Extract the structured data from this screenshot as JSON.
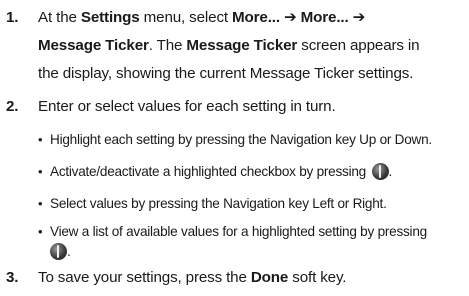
{
  "steps": [
    {
      "number": "1.",
      "lines": [
        [
          {
            "text": "At the ",
            "bold": false
          },
          {
            "text": "Settings",
            "bold": true
          },
          {
            "text": " menu, select ",
            "bold": false
          },
          {
            "text": "More... ➔ More... ➔",
            "bold": true
          }
        ],
        [
          {
            "text": "Message Ticker",
            "bold": true
          },
          {
            "text": ". The ",
            "bold": false
          },
          {
            "text": "Message Ticker",
            "bold": true
          },
          {
            "text": " screen appears in",
            "bold": false
          }
        ],
        [
          {
            "text": "the display, showing the current Message Ticker settings.",
            "bold": false
          }
        ]
      ]
    },
    {
      "number": "2.",
      "lines": [
        [
          {
            "text": "Enter or select values for each setting in turn.",
            "bold": false
          }
        ]
      ],
      "bullets": [
        "Highlight each setting by pressing the Navigation key Up or Down.",
        "Activate/deactivate a highlighted checkbox by pressing",
        "Select values by pressing the Navigation key Left or Right.",
        "View a list of available values for a highlighted setting by pressing"
      ]
    },
    {
      "number": "3.",
      "lines": [
        [
          {
            "text": "To save your settings, press the ",
            "bold": false
          },
          {
            "text": "Done",
            "bold": true
          },
          {
            "text": " soft key.",
            "bold": false
          }
        ]
      ]
    }
  ],
  "icons": {
    "select_key": "select-key-icon"
  }
}
